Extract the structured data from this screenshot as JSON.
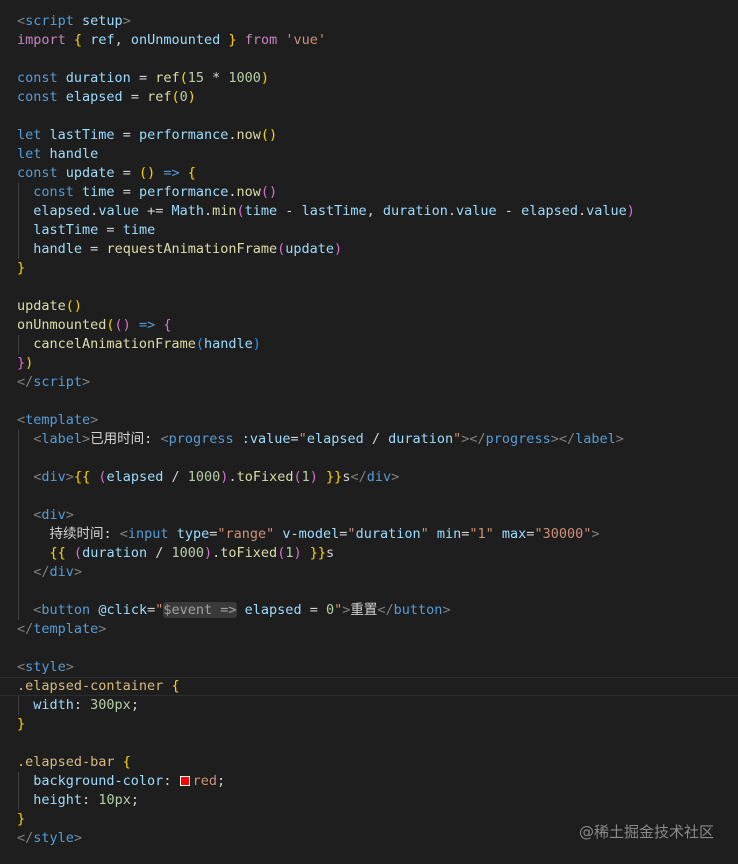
{
  "editor": {
    "language": "vue",
    "theme_colors": {
      "background": "#1e1e1e",
      "keyword": "#569cd6",
      "variable": "#9cdcfe",
      "function": "#dcdcaa",
      "string": "#ce9178",
      "number": "#b5cea8",
      "selector": "#d7ba7d",
      "control": "#c586c0"
    },
    "lines": [
      [
        [
          "ang",
          "<"
        ],
        [
          "tag",
          "script"
        ],
        [
          "attr",
          " setup"
        ],
        [
          "ang",
          ">"
        ]
      ],
      [
        [
          "ctrl",
          "import"
        ],
        [
          "txt",
          " "
        ],
        [
          "b1",
          "{"
        ],
        [
          "txt",
          " "
        ],
        [
          "var",
          "ref"
        ],
        [
          "txt",
          ", "
        ],
        [
          "var",
          "onUnmounted"
        ],
        [
          "txt",
          " "
        ],
        [
          "b1",
          "}"
        ],
        [
          "txt",
          " "
        ],
        [
          "ctrl",
          "from"
        ],
        [
          "txt",
          " "
        ],
        [
          "str",
          "'vue'"
        ]
      ],
      [],
      [
        [
          "kw",
          "const"
        ],
        [
          "txt",
          " "
        ],
        [
          "var",
          "duration"
        ],
        [
          "op",
          " = "
        ],
        [
          "fn",
          "ref"
        ],
        [
          "b1",
          "("
        ],
        [
          "num",
          "15"
        ],
        [
          "op",
          " * "
        ],
        [
          "num",
          "1000"
        ],
        [
          "b1",
          ")"
        ]
      ],
      [
        [
          "kw",
          "const"
        ],
        [
          "txt",
          " "
        ],
        [
          "var",
          "elapsed"
        ],
        [
          "op",
          " = "
        ],
        [
          "fn",
          "ref"
        ],
        [
          "b1",
          "("
        ],
        [
          "num",
          "0"
        ],
        [
          "b1",
          ")"
        ]
      ],
      [],
      [
        [
          "kw",
          "let"
        ],
        [
          "txt",
          " "
        ],
        [
          "var",
          "lastTime"
        ],
        [
          "op",
          " = "
        ],
        [
          "var",
          "performance"
        ],
        [
          "txt",
          "."
        ],
        [
          "fn",
          "now"
        ],
        [
          "b1",
          "()"
        ]
      ],
      [
        [
          "kw",
          "let"
        ],
        [
          "txt",
          " "
        ],
        [
          "var",
          "handle"
        ]
      ],
      [
        [
          "kw",
          "const"
        ],
        [
          "txt",
          " "
        ],
        [
          "var",
          "update"
        ],
        [
          "op",
          " = "
        ],
        [
          "b1",
          "()"
        ],
        [
          "op",
          " "
        ],
        [
          "kw",
          "=>"
        ],
        [
          "txt",
          " "
        ],
        [
          "b1",
          "{"
        ]
      ],
      [
        [
          "txt",
          "  "
        ],
        [
          "kw",
          "const"
        ],
        [
          "txt",
          " "
        ],
        [
          "var",
          "time"
        ],
        [
          "op",
          " = "
        ],
        [
          "var",
          "performance"
        ],
        [
          "txt",
          "."
        ],
        [
          "fn",
          "now"
        ],
        [
          "b2",
          "()"
        ]
      ],
      [
        [
          "txt",
          "  "
        ],
        [
          "var",
          "elapsed"
        ],
        [
          "txt",
          "."
        ],
        [
          "var",
          "value"
        ],
        [
          "op",
          " += "
        ],
        [
          "var",
          "Math"
        ],
        [
          "txt",
          "."
        ],
        [
          "fn",
          "min"
        ],
        [
          "b2",
          "("
        ],
        [
          "var",
          "time"
        ],
        [
          "op",
          " - "
        ],
        [
          "var",
          "lastTime"
        ],
        [
          "txt",
          ", "
        ],
        [
          "var",
          "duration"
        ],
        [
          "txt",
          "."
        ],
        [
          "var",
          "value"
        ],
        [
          "op",
          " - "
        ],
        [
          "var",
          "elapsed"
        ],
        [
          "txt",
          "."
        ],
        [
          "var",
          "value"
        ],
        [
          "b2",
          ")"
        ]
      ],
      [
        [
          "txt",
          "  "
        ],
        [
          "var",
          "lastTime"
        ],
        [
          "op",
          " = "
        ],
        [
          "var",
          "time"
        ]
      ],
      [
        [
          "txt",
          "  "
        ],
        [
          "var",
          "handle"
        ],
        [
          "op",
          " = "
        ],
        [
          "fn",
          "requestAnimationFrame"
        ],
        [
          "b2",
          "("
        ],
        [
          "var",
          "update"
        ],
        [
          "b2",
          ")"
        ]
      ],
      [
        [
          "b1",
          "}"
        ]
      ],
      [],
      [
        [
          "fn",
          "update"
        ],
        [
          "b1",
          "()"
        ]
      ],
      [
        [
          "fn",
          "onUnmounted"
        ],
        [
          "b1",
          "("
        ],
        [
          "b2",
          "()"
        ],
        [
          "op",
          " "
        ],
        [
          "kw",
          "=>"
        ],
        [
          "txt",
          " "
        ],
        [
          "b2",
          "{"
        ]
      ],
      [
        [
          "txt",
          "  "
        ],
        [
          "fn",
          "cancelAnimationFrame"
        ],
        [
          "b3",
          "("
        ],
        [
          "var",
          "handle"
        ],
        [
          "b3",
          ")"
        ]
      ],
      [
        [
          "b2",
          "}"
        ],
        [
          "b1",
          ")"
        ]
      ],
      [
        [
          "ang",
          "</"
        ],
        [
          "tag",
          "script"
        ],
        [
          "ang",
          ">"
        ]
      ],
      [],
      [
        [
          "ang",
          "<"
        ],
        [
          "tag",
          "template"
        ],
        [
          "ang",
          ">"
        ]
      ],
      [
        [
          "txt",
          "  "
        ],
        [
          "ang",
          "<"
        ],
        [
          "tag",
          "label"
        ],
        [
          "ang",
          ">"
        ],
        [
          "txt",
          "已用时间: "
        ],
        [
          "ang",
          "<"
        ],
        [
          "tag",
          "progress"
        ],
        [
          "attr",
          " :value"
        ],
        [
          "txt",
          "="
        ],
        [
          "str",
          "\""
        ],
        [
          "var",
          "elapsed"
        ],
        [
          "op",
          " / "
        ],
        [
          "var",
          "duration"
        ],
        [
          "str",
          "\""
        ],
        [
          "ang",
          "></"
        ],
        [
          "tag",
          "progress"
        ],
        [
          "ang",
          "></"
        ],
        [
          "tag",
          "label"
        ],
        [
          "ang",
          ">"
        ]
      ],
      [],
      [
        [
          "txt",
          "  "
        ],
        [
          "ang",
          "<"
        ],
        [
          "tag",
          "div"
        ],
        [
          "ang",
          ">"
        ],
        [
          "b1",
          "{{"
        ],
        [
          "txt",
          " "
        ],
        [
          "b2",
          "("
        ],
        [
          "var",
          "elapsed"
        ],
        [
          "op",
          " / "
        ],
        [
          "num",
          "1000"
        ],
        [
          "b2",
          ")"
        ],
        [
          "txt",
          "."
        ],
        [
          "fn",
          "toFixed"
        ],
        [
          "b2",
          "("
        ],
        [
          "num",
          "1"
        ],
        [
          "b2",
          ")"
        ],
        [
          "txt",
          " "
        ],
        [
          "b1",
          "}}"
        ],
        [
          "txt",
          "s"
        ],
        [
          "ang",
          "</"
        ],
        [
          "tag",
          "div"
        ],
        [
          "ang",
          ">"
        ]
      ],
      [],
      [
        [
          "txt",
          "  "
        ],
        [
          "ang",
          "<"
        ],
        [
          "tag",
          "div"
        ],
        [
          "ang",
          ">"
        ]
      ],
      [
        [
          "txt",
          "    持续时间: "
        ],
        [
          "ang",
          "<"
        ],
        [
          "tag",
          "input"
        ],
        [
          "attr",
          " type"
        ],
        [
          "txt",
          "="
        ],
        [
          "str",
          "\"range\""
        ],
        [
          "attr",
          " v-model"
        ],
        [
          "txt",
          "="
        ],
        [
          "str",
          "\""
        ],
        [
          "var",
          "duration"
        ],
        [
          "str",
          "\""
        ],
        [
          "attr",
          " min"
        ],
        [
          "txt",
          "="
        ],
        [
          "str",
          "\"1\""
        ],
        [
          "attr",
          " max"
        ],
        [
          "txt",
          "="
        ],
        [
          "str",
          "\"30000\""
        ],
        [
          "ang",
          ">"
        ]
      ],
      [
        [
          "txt",
          "    "
        ],
        [
          "b1",
          "{{"
        ],
        [
          "txt",
          " "
        ],
        [
          "b2",
          "("
        ],
        [
          "var",
          "duration"
        ],
        [
          "op",
          " / "
        ],
        [
          "num",
          "1000"
        ],
        [
          "b2",
          ")"
        ],
        [
          "txt",
          "."
        ],
        [
          "fn",
          "toFixed"
        ],
        [
          "b2",
          "("
        ],
        [
          "num",
          "1"
        ],
        [
          "b2",
          ")"
        ],
        [
          "txt",
          " "
        ],
        [
          "b1",
          "}}"
        ],
        [
          "txt",
          "s"
        ]
      ],
      [
        [
          "txt",
          "  "
        ],
        [
          "ang",
          "</"
        ],
        [
          "tag",
          "div"
        ],
        [
          "ang",
          ">"
        ]
      ],
      [],
      [
        [
          "txt",
          "  "
        ],
        [
          "ang",
          "<"
        ],
        [
          "tag",
          "button"
        ],
        [
          "attr",
          " @click"
        ],
        [
          "txt",
          "="
        ],
        [
          "str",
          "\""
        ],
        [
          "hint",
          "$event =>"
        ],
        [
          "txt",
          " "
        ],
        [
          "var",
          "elapsed"
        ],
        [
          "op",
          " = "
        ],
        [
          "num",
          "0"
        ],
        [
          "str",
          "\""
        ],
        [
          "ang",
          ">"
        ],
        [
          "txt",
          "重置"
        ],
        [
          "ang",
          "</"
        ],
        [
          "tag",
          "button"
        ],
        [
          "ang",
          ">"
        ]
      ],
      [
        [
          "ang",
          "</"
        ],
        [
          "tag",
          "template"
        ],
        [
          "ang",
          ">"
        ]
      ],
      [],
      [
        [
          "ang",
          "<"
        ],
        [
          "tag",
          "style"
        ],
        [
          "ang",
          ">"
        ]
      ],
      [
        [
          "sel",
          ".elapsed-container"
        ],
        [
          "txt",
          " "
        ],
        [
          "b1",
          "{"
        ]
      ],
      [
        [
          "txt",
          "  "
        ],
        [
          "prop",
          "width"
        ],
        [
          "txt",
          ": "
        ],
        [
          "num",
          "300px"
        ],
        [
          "txt",
          ";"
        ]
      ],
      [
        [
          "b1",
          "}"
        ]
      ],
      [],
      [
        [
          "sel",
          ".elapsed-bar"
        ],
        [
          "txt",
          " "
        ],
        [
          "b1",
          "{"
        ]
      ],
      [
        [
          "txt",
          "  "
        ],
        [
          "prop",
          "background-color"
        ],
        [
          "txt",
          ": "
        ],
        [
          "swatch",
          "red"
        ],
        [
          "str",
          "red"
        ],
        [
          "txt",
          ";"
        ]
      ],
      [
        [
          "txt",
          "  "
        ],
        [
          "prop",
          "height"
        ],
        [
          "txt",
          ": "
        ],
        [
          "num",
          "10px"
        ],
        [
          "txt",
          ";"
        ]
      ],
      [
        [
          "b1",
          "}"
        ]
      ],
      [
        [
          "ang",
          "</"
        ],
        [
          "tag",
          "style"
        ],
        [
          "ang",
          ">"
        ]
      ]
    ]
  },
  "watermark": "@稀土掘金技术社区"
}
